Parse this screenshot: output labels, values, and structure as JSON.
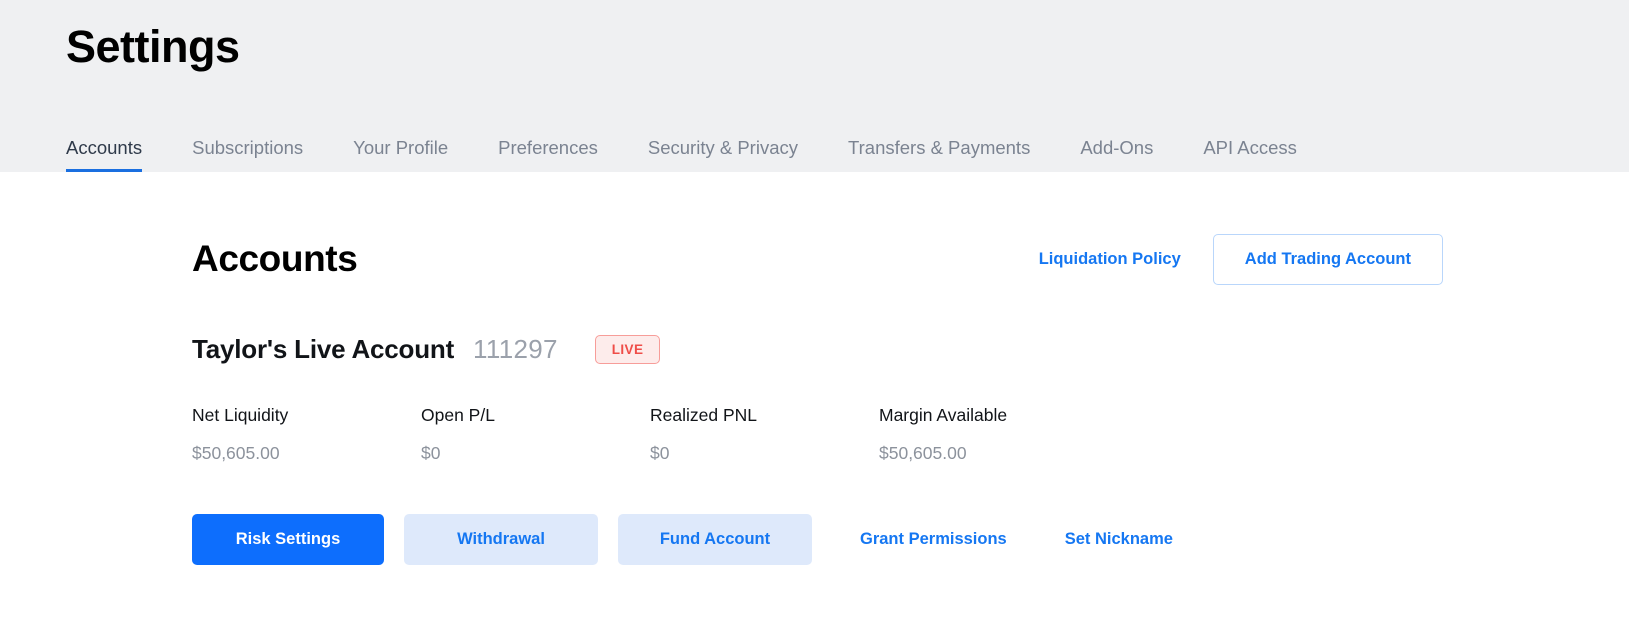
{
  "header": {
    "title": "Settings",
    "tabs": [
      {
        "label": "Accounts",
        "active": true
      },
      {
        "label": "Subscriptions",
        "active": false
      },
      {
        "label": "Your Profile",
        "active": false
      },
      {
        "label": "Preferences",
        "active": false
      },
      {
        "label": "Security & Privacy",
        "active": false
      },
      {
        "label": "Transfers & Payments",
        "active": false
      },
      {
        "label": "Add-Ons",
        "active": false
      },
      {
        "label": "API Access",
        "active": false
      }
    ]
  },
  "main": {
    "section_title": "Accounts",
    "liquidation_policy_label": "Liquidation Policy",
    "add_trading_account_label": "Add Trading Account",
    "account": {
      "name": "Taylor's Live Account",
      "id": "111297",
      "status_badge": "LIVE",
      "stats": [
        {
          "label": "Net Liquidity",
          "value": "$50,605.00"
        },
        {
          "label": "Open P/L",
          "value": "$0"
        },
        {
          "label": "Realized PNL",
          "value": "$0"
        },
        {
          "label": "Margin Available",
          "value": "$50,605.00"
        }
      ],
      "actions": {
        "risk_settings": "Risk Settings",
        "withdrawal": "Withdrawal",
        "fund_account": "Fund Account",
        "grant_permissions": "Grant Permissions",
        "set_nickname": "Set Nickname"
      }
    }
  },
  "colors": {
    "accent_blue": "#1577f2",
    "primary_blue": "#0d6efd",
    "soft_blue_bg": "#dee9fb",
    "header_bg": "#eff0f2",
    "live_badge_bg": "#fdeceb",
    "live_badge_text": "#ef4d48",
    "tab_active_underline": "#1a6fe0",
    "muted_text": "#8c929c"
  }
}
